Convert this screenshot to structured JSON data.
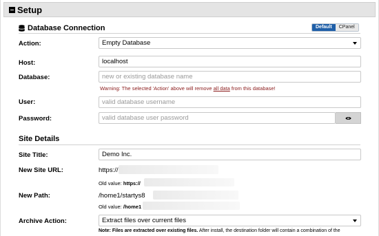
{
  "header": {
    "title": "Setup"
  },
  "database": {
    "section_title": "Database Connection",
    "toggle": {
      "default_label": "Default",
      "cpanel_label": "CPanel"
    },
    "action": {
      "label": "Action:",
      "value": "Empty Database"
    },
    "host": {
      "label": "Host:",
      "value": "localhost"
    },
    "database": {
      "label": "Database:",
      "placeholder": "new or existing database name"
    },
    "warning": {
      "before": "Warning: The selected 'Action' above will remove ",
      "underlined": "all data",
      "after": " from this database!"
    },
    "user": {
      "label": "User:",
      "placeholder": "valid database username"
    },
    "password": {
      "label": "Password:",
      "placeholder": "valid database user password"
    }
  },
  "site": {
    "section_title": "Site Details",
    "title": {
      "label": "Site Title:",
      "value": "Demo Inc."
    },
    "url": {
      "label": "New Site URL:",
      "value": "https://",
      "old_label": "Old value:",
      "old_value": "https://"
    },
    "path": {
      "label": "New Path:",
      "value": "/home1/startys8",
      "old_label": "Old value:",
      "old_value": "/home1"
    },
    "archive": {
      "label": "Archive Action:",
      "value": "Extract files over current files"
    },
    "note": {
      "prefix": "Note:",
      "bold": "Files are extracted over existing files.",
      "rest": " After install, the destination folder will contain a combination of the"
    }
  },
  "colors": {
    "accent": "#1f5fa8",
    "warning": "#8a1a1a",
    "header_bg": "#e4e4e4"
  },
  "icons": {
    "collapse": "minus-box-icon",
    "database": "database-icon",
    "show_password": "eye-icon"
  }
}
